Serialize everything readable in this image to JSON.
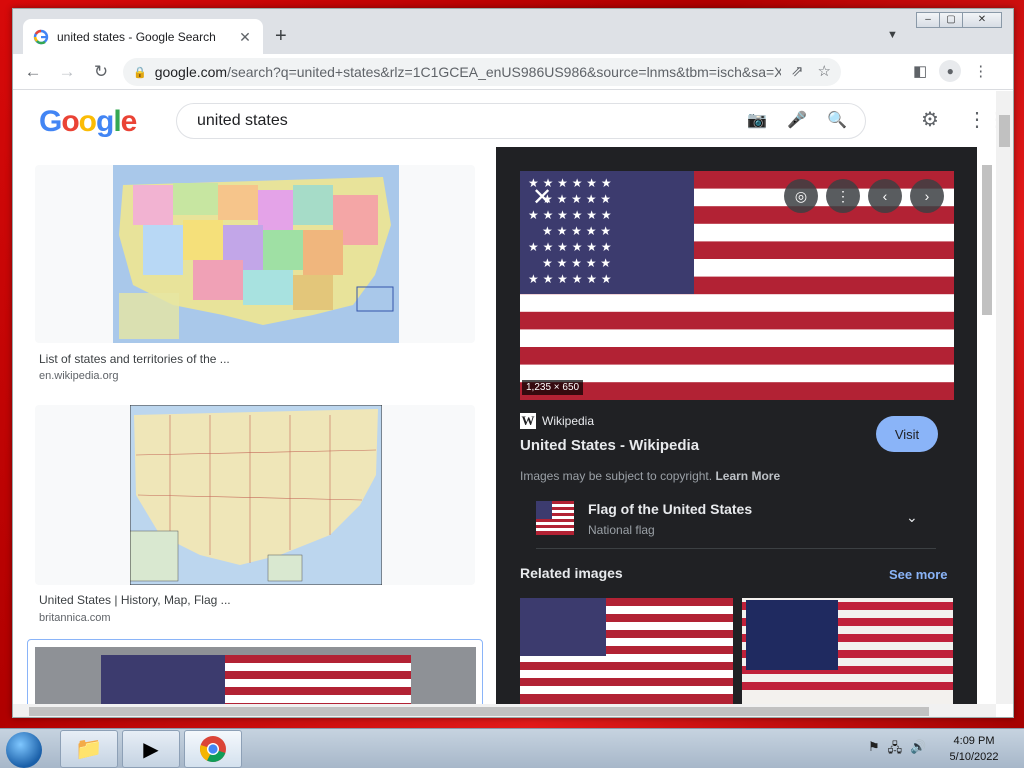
{
  "browser": {
    "tab_title": "united states - Google Search",
    "tab_close": "✕",
    "new_tab": "+",
    "url_host": "google.com",
    "url_path": "/search?q=united+states&rlz=1C1GCEA_enUS986US986&source=lnms&tbm=isch&sa=X&ved=...",
    "win_min": "–",
    "win_max": "▢",
    "win_close": "✕"
  },
  "google": {
    "logo_letters": [
      "G",
      "o",
      "o",
      "g",
      "l",
      "e"
    ],
    "logo_colors": [
      "#4285f4",
      "#ea4335",
      "#fbbc05",
      "#4285f4",
      "#34a853",
      "#ea4335"
    ],
    "search_value": "united states"
  },
  "results": [
    {
      "caption": "List of states and territories of the ...",
      "source": "en.wikipedia.org"
    },
    {
      "caption": "United States | History, Map, Flag ...",
      "source": "britannica.com"
    }
  ],
  "preview": {
    "dimensions": "1,235 × 650",
    "source_name": "Wikipedia",
    "title": "United States - Wikipedia",
    "visit_label": "Visit",
    "copyright_text": "Images may be subject to copyright.",
    "learn_more": "Learn More",
    "entity_name": "Flag of the United States",
    "entity_sub": "National flag",
    "related_label": "Related images",
    "see_more": "See more"
  },
  "taskbar": {
    "time": "4:09 PM",
    "date": "5/10/2022"
  },
  "colors": {
    "flag_red": "#b22234",
    "flag_blue": "#3c3b6e",
    "panel_bg": "#202124",
    "visit_bg": "#8ab4f8"
  }
}
